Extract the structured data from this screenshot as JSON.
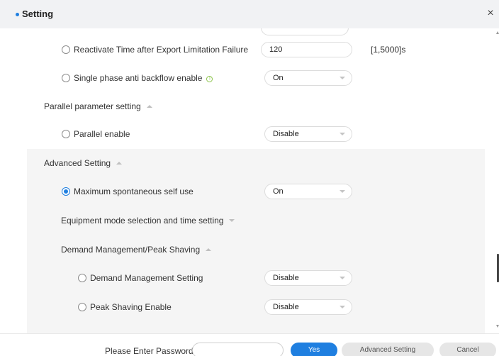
{
  "dialog": {
    "title": "Setting",
    "close_glyph": "×"
  },
  "rows": {
    "reactivate": {
      "label": "Reactivate Time after Export Limitation Failure",
      "value": "120",
      "range": "[1,5000]s"
    },
    "single_phase": {
      "label": "Single phase anti backflow enable",
      "value": "On"
    },
    "parallel_section": {
      "label": "Parallel parameter setting"
    },
    "parallel_enable": {
      "label": "Parallel enable",
      "value": "Disable"
    },
    "advanced_section": {
      "label": "Advanced Setting"
    },
    "max_self_use": {
      "label": "Maximum spontaneous self use",
      "value": "On"
    },
    "equipment_mode": {
      "label": "Equipment mode selection and time setting"
    },
    "demand_section": {
      "label": "Demand Management/Peak Shaving"
    },
    "demand_setting": {
      "label": "Demand Management Setting",
      "value": "Disable"
    },
    "peak_shaving": {
      "label": "Peak Shaving Enable",
      "value": "Disable"
    }
  },
  "footer": {
    "password_label": "Please Enter Password",
    "password_placeholder": "",
    "yes_label": "Yes",
    "advanced_label": "Advanced Setting",
    "cancel_label": "Cancel"
  },
  "colors": {
    "accent": "#1f7fe0",
    "info": "#8bc34a"
  }
}
